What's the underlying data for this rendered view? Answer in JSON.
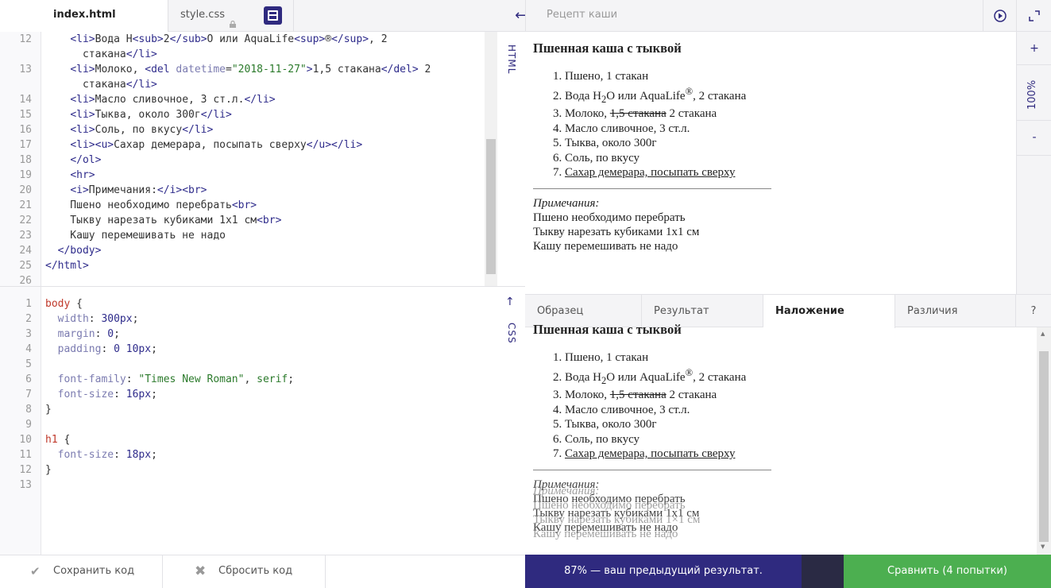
{
  "tabs": {
    "index_label": "index.html",
    "style_label": "style.css"
  },
  "preview_title": "Рецепт каши",
  "zoom": "100%",
  "rail": {
    "plus": "+",
    "minus": "-"
  },
  "side_labels": {
    "html": "HTML",
    "css": "CSS"
  },
  "html_code": {
    "line_numbers": [
      "12",
      "13",
      "14",
      "15",
      "16",
      "17",
      "18",
      "19",
      "20",
      "21",
      "22",
      "23",
      "24",
      "25",
      "26"
    ]
  },
  "css_code": {
    "line_numbers": [
      "1",
      "2",
      "3",
      "4",
      "5",
      "6",
      "7",
      "8",
      "9",
      "10",
      "11",
      "12",
      "13"
    ]
  },
  "preview": {
    "heading": "Пшенная каша с тыквой",
    "items": [
      "Пшено, 1 стакан",
      "2 стакана",
      "Молоко,",
      "Масло сливочное, 3 ст.л.",
      "Тыква, около 300г",
      "Соль, по вкусу",
      "Сахар демерара, посыпать сверху"
    ],
    "water_prefix": "Вода H",
    "water_sub": "2",
    "water_mid": "O или AquaLife",
    "water_sup": "®",
    "water_suffix": ", 2 стакана",
    "milk_del": "1,5 стакана",
    "milk_new": " 2 стакана",
    "note_title": "Примечания:",
    "notes": [
      "Пшено необходимо перебрать",
      "Тыкву нарезать кубиками 1х1 см",
      "Кашу перемешивать не надо"
    ],
    "notes_overlay": [
      "Пшено необходимо перебрать",
      "Тыкву нарезать кубиками 1×1 см",
      "Кашу перемешивать не надо"
    ]
  },
  "preview_tabs": [
    "Образец",
    "Результат",
    "Наложение",
    "Различия",
    "?"
  ],
  "bottom": {
    "save": "Сохранить код",
    "reset": "Сбросить код",
    "result": "87% — ваш предыдущий результат.",
    "compare": "Сравнить (4 попытки)"
  }
}
